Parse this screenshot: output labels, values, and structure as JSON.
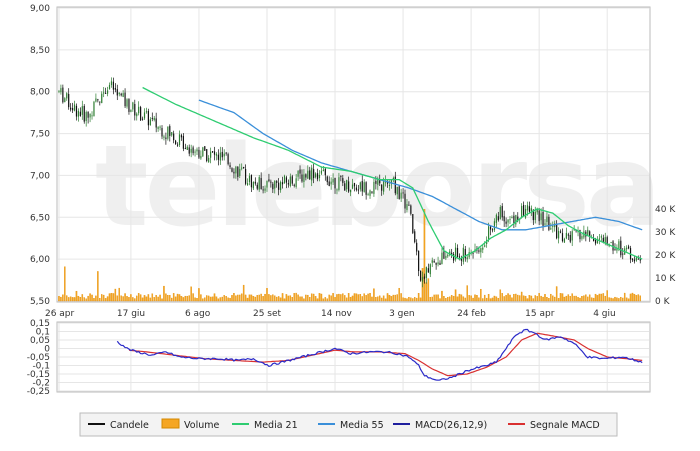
{
  "chart_data": [
    {
      "type": "candlestick",
      "panel": "price",
      "ylim": [
        5.5,
        9.0
      ],
      "yticks": [
        "9,00",
        "8,50",
        "8,00",
        "7,50",
        "7,00",
        "6,50",
        "6,00",
        "5,50"
      ],
      "ytick_values": [
        9.0,
        8.5,
        8.0,
        7.5,
        7.0,
        6.5,
        6.0,
        5.5
      ],
      "xticks": [
        "26 apr",
        "17 giu",
        "6 ago",
        "25 set",
        "14 nov",
        "3 gen",
        "24 feb",
        "15 apr",
        "4 giu"
      ],
      "xtick_positions": [
        0,
        37,
        72,
        107,
        142,
        177,
        212,
        247,
        282
      ],
      "volume_axis": {
        "ticks": [
          "40 K",
          "30 K",
          "20 K",
          "10 K",
          "0 K"
        ],
        "tick_values": [
          40,
          30,
          20,
          10,
          0
        ],
        "ylim": [
          0,
          44
        ]
      },
      "ma21_anchors": [
        [
          43,
          8.05
        ],
        [
          60,
          7.85
        ],
        [
          80,
          7.65
        ],
        [
          100,
          7.45
        ],
        [
          118,
          7.3
        ],
        [
          135,
          7.1
        ],
        [
          150,
          7.05
        ],
        [
          165,
          6.95
        ],
        [
          175,
          6.95
        ],
        [
          182,
          6.85
        ],
        [
          190,
          6.45
        ],
        [
          198,
          6.1
        ],
        [
          206,
          6.0
        ],
        [
          214,
          6.1
        ],
        [
          222,
          6.25
        ],
        [
          230,
          6.35
        ],
        [
          238,
          6.5
        ],
        [
          246,
          6.6
        ],
        [
          254,
          6.55
        ],
        [
          262,
          6.4
        ],
        [
          270,
          6.3
        ],
        [
          280,
          6.2
        ],
        [
          290,
          6.1
        ],
        [
          300,
          6.0
        ]
      ],
      "ma55_anchors": [
        [
          72,
          7.9
        ],
        [
          90,
          7.75
        ],
        [
          105,
          7.5
        ],
        [
          120,
          7.3
        ],
        [
          135,
          7.15
        ],
        [
          150,
          7.05
        ],
        [
          165,
          6.95
        ],
        [
          180,
          6.85
        ],
        [
          192,
          6.75
        ],
        [
          204,
          6.6
        ],
        [
          216,
          6.45
        ],
        [
          228,
          6.35
        ],
        [
          240,
          6.35
        ],
        [
          252,
          6.4
        ],
        [
          264,
          6.45
        ],
        [
          276,
          6.5
        ],
        [
          288,
          6.45
        ],
        [
          300,
          6.35
        ]
      ]
    },
    {
      "type": "line",
      "panel": "macd",
      "ylim": [
        -0.25,
        0.15
      ],
      "yticks": [
        "0,15",
        "0,1",
        "0,05",
        "0",
        "-0,05",
        "-0,1",
        "-0,15",
        "-0,2",
        "-0,25"
      ],
      "ytick_values": [
        0.15,
        0.1,
        0.05,
        0,
        -0.05,
        -0.1,
        -0.15,
        -0.2,
        -0.25
      ],
      "macd_anchors": [
        [
          30,
          0.04
        ],
        [
          35,
          0.0
        ],
        [
          40,
          -0.02
        ],
        [
          48,
          -0.04
        ],
        [
          55,
          -0.02
        ],
        [
          62,
          -0.05
        ],
        [
          72,
          -0.06
        ],
        [
          82,
          -0.06
        ],
        [
          92,
          -0.07
        ],
        [
          100,
          -0.06
        ],
        [
          108,
          -0.1
        ],
        [
          115,
          -0.08
        ],
        [
          125,
          -0.05
        ],
        [
          135,
          -0.02
        ],
        [
          142,
          0.0
        ],
        [
          150,
          -0.03
        ],
        [
          160,
          -0.02
        ],
        [
          168,
          -0.02
        ],
        [
          174,
          -0.03
        ],
        [
          180,
          -0.05
        ],
        [
          185,
          -0.1
        ],
        [
          188,
          -0.16
        ],
        [
          195,
          -0.19
        ],
        [
          202,
          -0.17
        ],
        [
          210,
          -0.13
        ],
        [
          220,
          -0.1
        ],
        [
          225,
          -0.08
        ],
        [
          230,
          0.0
        ],
        [
          235,
          0.08
        ],
        [
          240,
          0.11
        ],
        [
          245,
          0.09
        ],
        [
          250,
          0.05
        ],
        [
          258,
          0.07
        ],
        [
          265,
          0.03
        ],
        [
          272,
          -0.05
        ],
        [
          280,
          -0.06
        ],
        [
          290,
          -0.05
        ],
        [
          300,
          -0.08
        ]
      ],
      "signal_anchors": [
        [
          36,
          -0.01
        ],
        [
          45,
          -0.02
        ],
        [
          60,
          -0.04
        ],
        [
          75,
          -0.06
        ],
        [
          90,
          -0.07
        ],
        [
          105,
          -0.08
        ],
        [
          118,
          -0.07
        ],
        [
          130,
          -0.04
        ],
        [
          142,
          -0.01
        ],
        [
          152,
          -0.02
        ],
        [
          165,
          -0.02
        ],
        [
          178,
          -0.03
        ],
        [
          185,
          -0.07
        ],
        [
          192,
          -0.12
        ],
        [
          200,
          -0.16
        ],
        [
          210,
          -0.15
        ],
        [
          220,
          -0.11
        ],
        [
          230,
          -0.05
        ],
        [
          238,
          0.05
        ],
        [
          246,
          0.09
        ],
        [
          256,
          0.07
        ],
        [
          265,
          0.05
        ],
        [
          272,
          0.0
        ],
        [
          282,
          -0.05
        ],
        [
          292,
          -0.06
        ],
        [
          300,
          -0.07
        ]
      ],
      "series_colors": {
        "macd": "#2a2ac8",
        "signal": "#d93030"
      }
    }
  ],
  "legend": [
    {
      "label": "Candele",
      "color": "#111111",
      "kind": "line"
    },
    {
      "label": "Volume",
      "color": "#f5a623",
      "kind": "box"
    },
    {
      "label": "Media 21",
      "color": "#2ecc71",
      "kind": "line"
    },
    {
      "label": "Media 55",
      "color": "#3a8fd9",
      "kind": "line"
    },
    {
      "label": "MACD(26,12,9)",
      "color": "#1f1f9e",
      "kind": "line"
    },
    {
      "label": "Segnale MACD",
      "color": "#d93030",
      "kind": "line"
    }
  ],
  "watermark": "teleborsa",
  "colors": {
    "up": "#2e7d32",
    "down": "#111111",
    "volume": "#f5a623",
    "grid": "#e6e6e6",
    "frame": "#bbbbbb"
  }
}
